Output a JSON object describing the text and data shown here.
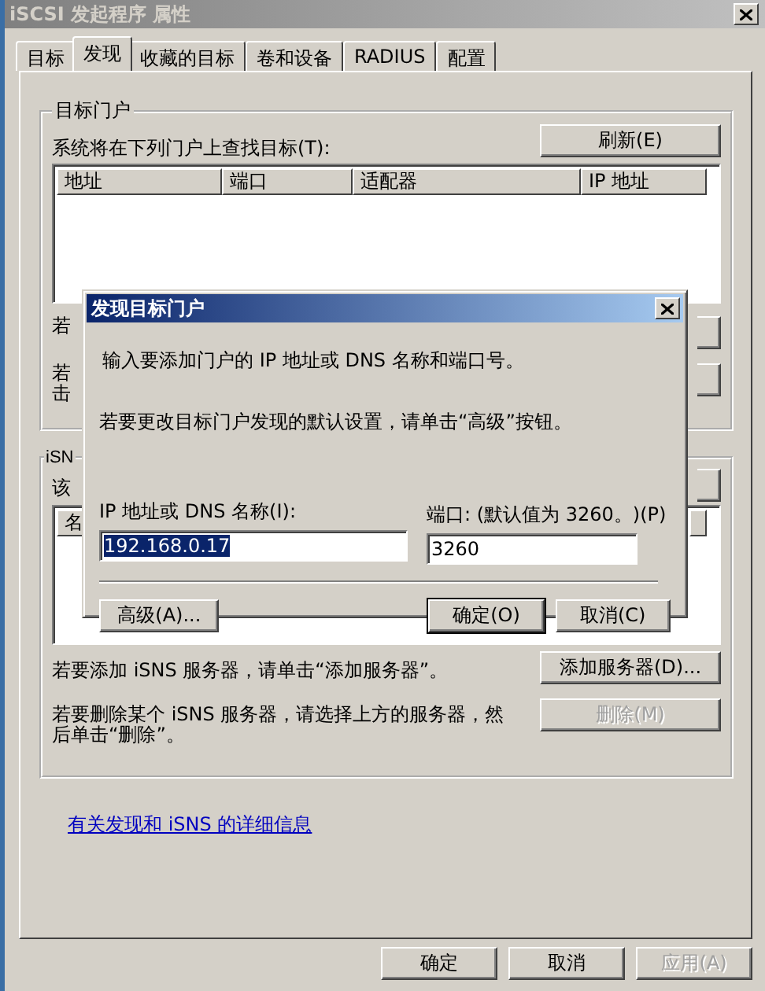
{
  "window": {
    "title": "iSCSI 发起程序 属性"
  },
  "tabs": [
    {
      "label": "目标",
      "selected": false
    },
    {
      "label": "发现",
      "selected": true
    },
    {
      "label": "收藏的目标",
      "selected": false
    },
    {
      "label": "卷和设备",
      "selected": false
    },
    {
      "label": "RADIUS",
      "selected": false
    },
    {
      "label": "配置",
      "selected": false
    }
  ],
  "portal_group": {
    "title": "目标门户",
    "list_label": "系统将在下列门户上查找目标(T):",
    "refresh_button": "刷新(E)",
    "columns": [
      "地址",
      "端口",
      "适配器",
      "IP 地址"
    ],
    "hint_1": "若",
    "hint_2": "若",
    "hint_3": "击"
  },
  "isns_group": {
    "title": "iSN",
    "list_label": "该",
    "columns": [
      "名"
    ],
    "add_hint": "若要添加 iSNS 服务器，请单击“添加服务器”。",
    "add_button": "添加服务器(D)...",
    "remove_hint": "若要删除某个 iSNS 服务器，请选择上方的服务器，然后单击“删除”。",
    "remove_button": {
      "label": "删除(M)",
      "disabled": true
    }
  },
  "link": "有关发现和 iSNS 的详细信息",
  "footer_buttons": [
    {
      "label": "确定",
      "disabled": false
    },
    {
      "label": "取消",
      "disabled": false
    },
    {
      "label": "应用(A)",
      "disabled": true
    }
  ],
  "dialog": {
    "title": "发现目标门户",
    "intro": "输入要添加门户的 IP 地址或 DNS 名称和端口号。",
    "advanced_hint": "若要更改目标门户发现的默认设置，请单击“高级”按钮。",
    "ip_field": {
      "label": "IP 地址或 DNS 名称(I):",
      "value": "192.168.0.17",
      "selected": true
    },
    "port_field": {
      "label": "端口: (默认值为 3260。)(P)",
      "value": "3260"
    },
    "buttons": [
      {
        "label": "高级(A)...",
        "default": false
      },
      {
        "label": "确定(O)",
        "default": true
      },
      {
        "label": "取消(C)",
        "default": false
      }
    ]
  }
}
